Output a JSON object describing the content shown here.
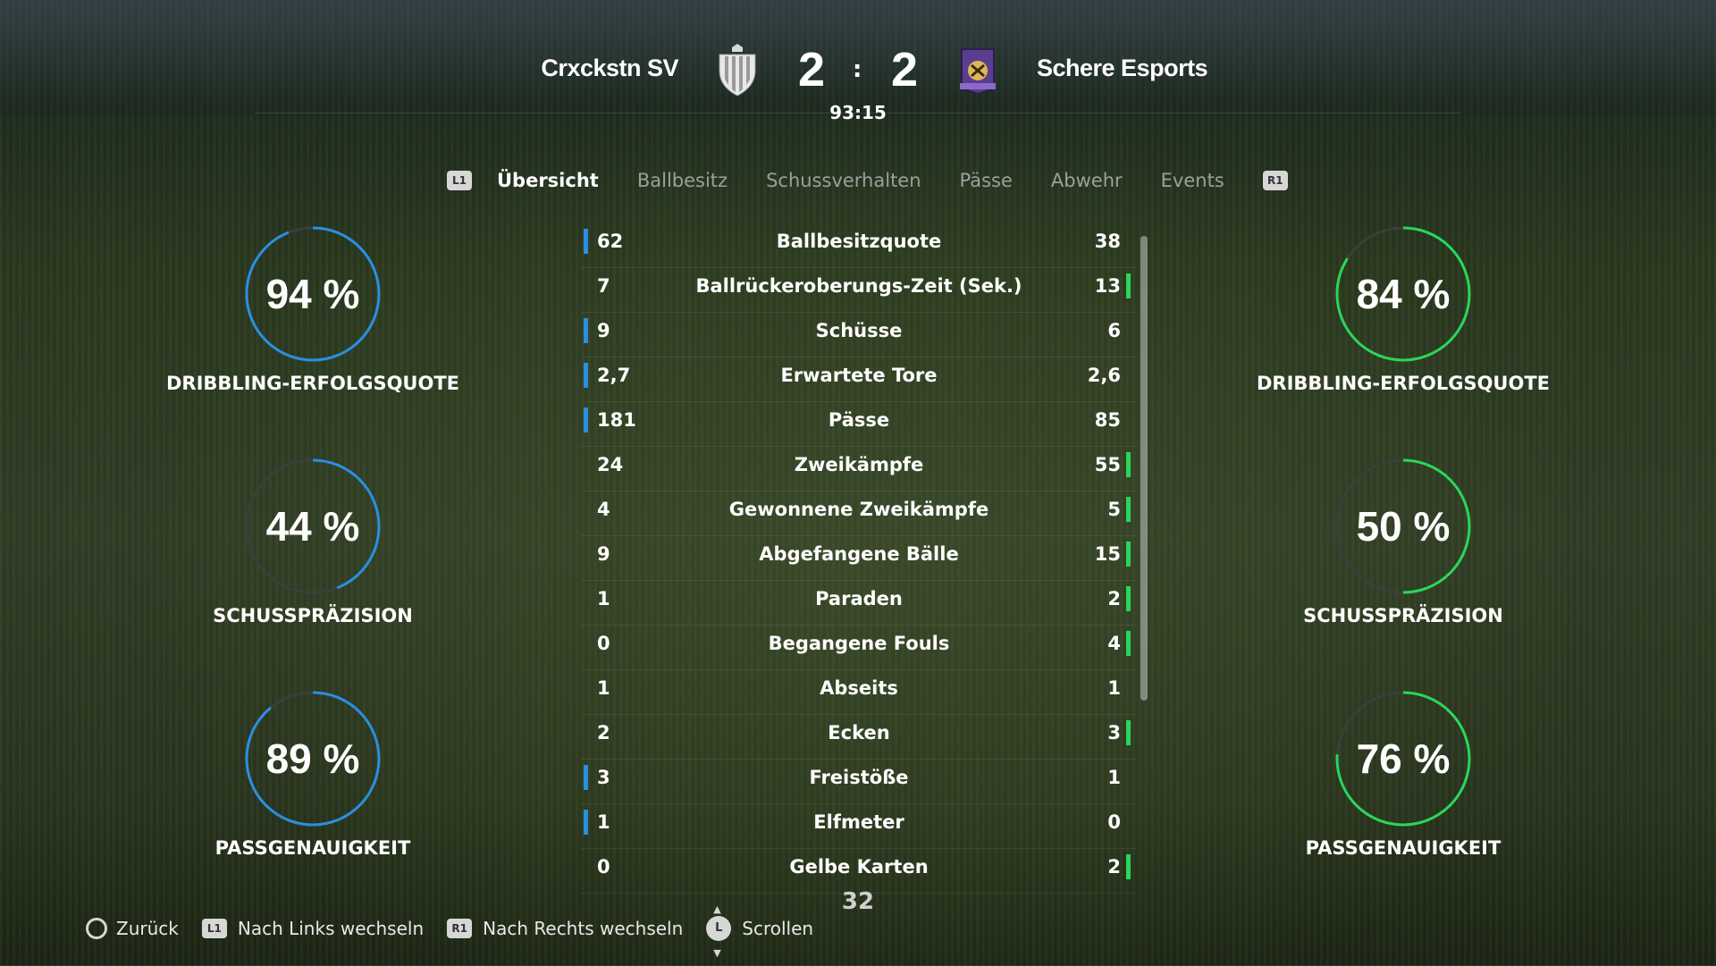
{
  "match": {
    "home_team": "Crxckstn SV",
    "away_team": "Schere Esports",
    "home_score": "2",
    "separator": ":",
    "away_score": "2",
    "clock": "93:15"
  },
  "tabs": {
    "l1": "L1",
    "r1": "R1",
    "items": [
      "Übersicht",
      "Ballbesitz",
      "Schussverhalten",
      "Pässe",
      "Abwehr",
      "Events"
    ],
    "active": "Übersicht"
  },
  "home_gauges": [
    {
      "value": "94 %",
      "percent": 94,
      "label": "DRIBBLING-ERFOLGSQUOTE"
    },
    {
      "value": "44 %",
      "percent": 44,
      "label": "SCHUSSPRÄZISION"
    },
    {
      "value": "89 %",
      "percent": 89,
      "label": "PASSGENAUIGKEIT"
    }
  ],
  "away_gauges": [
    {
      "value": "84 %",
      "percent": 84,
      "label": "DRIBBLING-ERFOLGSQUOTE"
    },
    {
      "value": "50 %",
      "percent": 50,
      "label": "SCHUSSPRÄZISION"
    },
    {
      "value": "76 %",
      "percent": 76,
      "label": "PASSGENAUIGKEIT"
    }
  ],
  "colors": {
    "home": "#2a8fe0",
    "away": "#2ad65a",
    "track": "#3a3f3a"
  },
  "stats": [
    {
      "home": "62",
      "label": "Ballbesitzquote",
      "away": "38",
      "lead": "home"
    },
    {
      "home": "7",
      "label": "Ballrückeroberungs-Zeit (Sek.)",
      "away": "13",
      "lead": "away"
    },
    {
      "home": "9",
      "label": "Schüsse",
      "away": "6",
      "lead": "home"
    },
    {
      "home": "2,7",
      "label": "Erwartete Tore",
      "away": "2,6",
      "lead": "home"
    },
    {
      "home": "181",
      "label": "Pässe",
      "away": "85",
      "lead": "home"
    },
    {
      "home": "24",
      "label": "Zweikämpfe",
      "away": "55",
      "lead": "away"
    },
    {
      "home": "4",
      "label": "Gewonnene Zweikämpfe",
      "away": "5",
      "lead": "away"
    },
    {
      "home": "9",
      "label": "Abgefangene Bälle",
      "away": "15",
      "lead": "away"
    },
    {
      "home": "1",
      "label": "Paraden",
      "away": "2",
      "lead": "away"
    },
    {
      "home": "0",
      "label": "Begangene Fouls",
      "away": "4",
      "lead": "away"
    },
    {
      "home": "1",
      "label": "Abseits",
      "away": "1",
      "lead": "none"
    },
    {
      "home": "2",
      "label": "Ecken",
      "away": "3",
      "lead": "away"
    },
    {
      "home": "3",
      "label": "Freistöße",
      "away": "1",
      "lead": "home"
    },
    {
      "home": "1",
      "label": "Elfmeter",
      "away": "0",
      "lead": "home"
    },
    {
      "home": "0",
      "label": "Gelbe Karten",
      "away": "2",
      "lead": "away"
    }
  ],
  "page_number": "32",
  "footer": {
    "back": "Zurück",
    "l1_badge": "L1",
    "prev": "Nach Links wechseln",
    "r1_badge": "R1",
    "next": "Nach Rechts wechseln",
    "stick_badge": "L",
    "scroll": "Scrollen"
  }
}
